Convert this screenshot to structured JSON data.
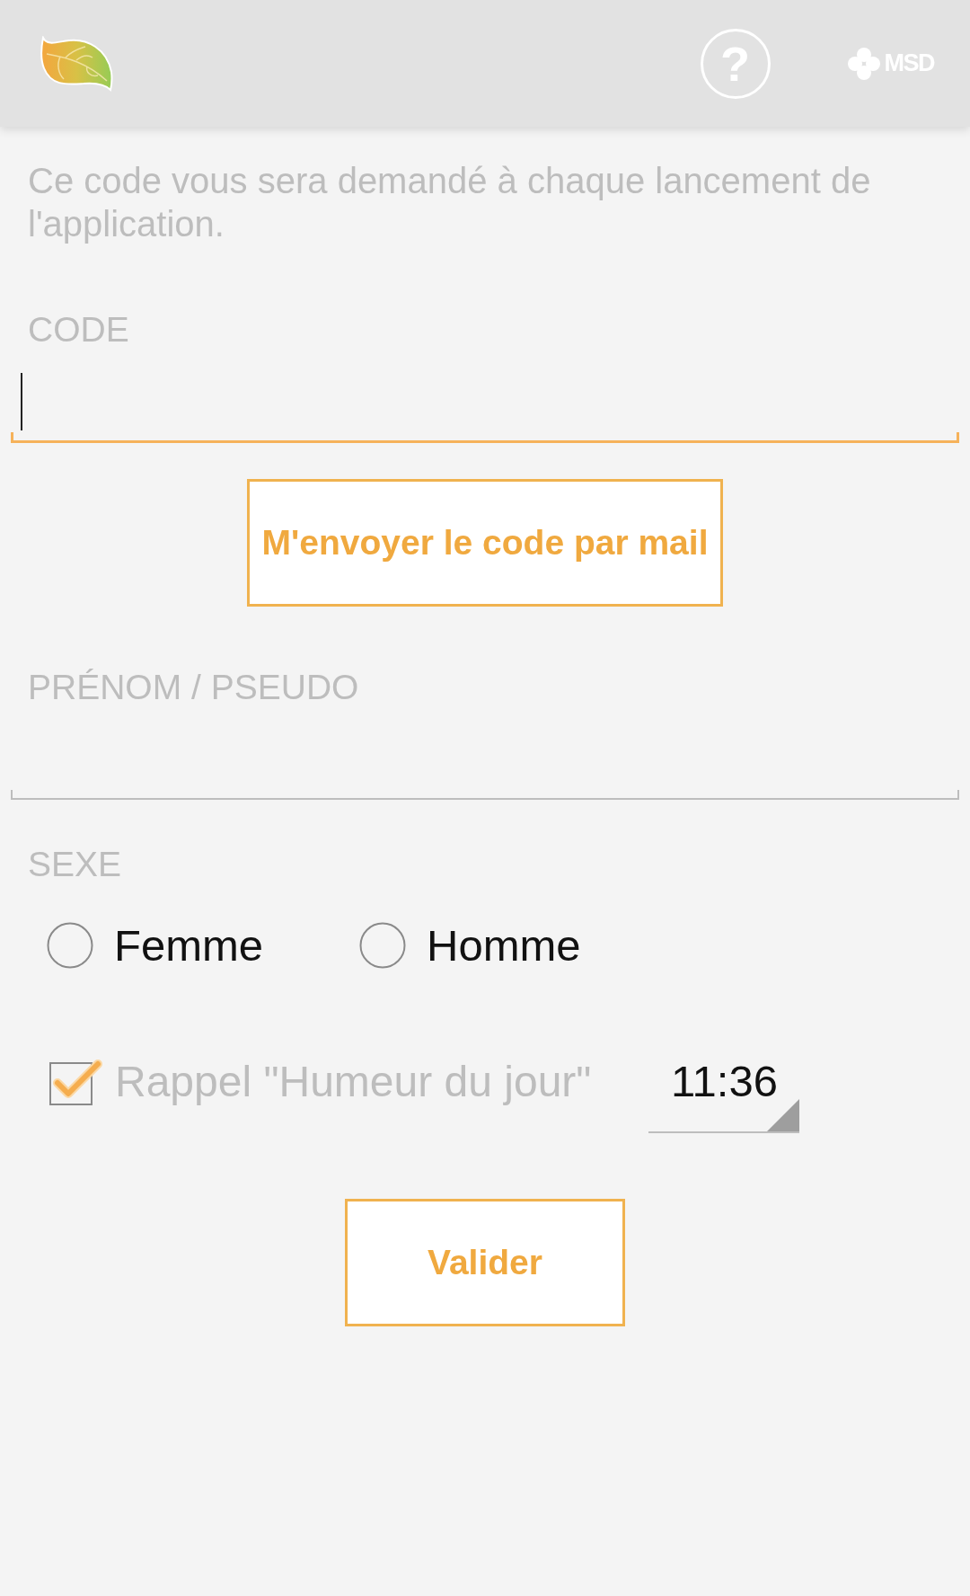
{
  "app_bar": {
    "help": "?",
    "brand": "MSD"
  },
  "intro": "Ce code vous sera demandé à chaque lancement de l'application.",
  "code_field": {
    "label": "CODE",
    "focused": true
  },
  "send_code_button": "M'envoyer le code par mail",
  "name_field": {
    "label": "PRÉNOM / PSEUDO",
    "focused": false
  },
  "sex": {
    "label": "SEXE",
    "options": [
      {
        "label": "Femme",
        "selected": false
      },
      {
        "label": "Homme",
        "selected": false
      }
    ]
  },
  "reminder": {
    "label": "Rappel \"Humeur du jour\"",
    "checked": true,
    "time": "11:36"
  },
  "submit_button": "Valider"
}
